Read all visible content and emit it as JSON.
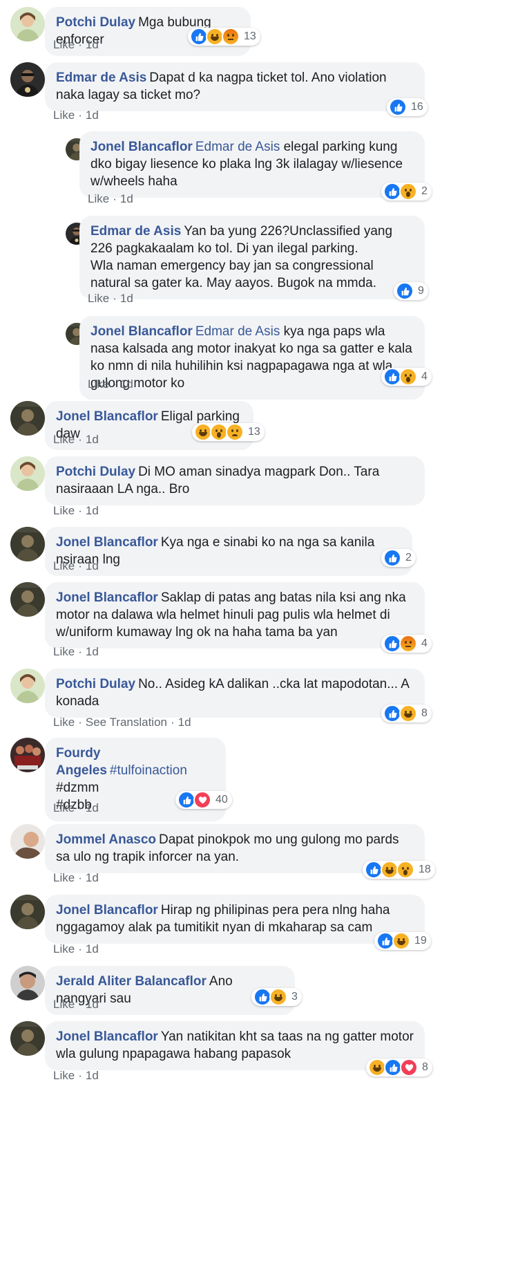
{
  "comments": [
    {
      "name": "Potchi Dulay",
      "text": "Mga bubung enforcer",
      "like": "Like",
      "time": "1d",
      "reactions": [
        "like",
        "haha",
        "angry"
      ],
      "count": "13"
    },
    {
      "name": "Edmar de Asis",
      "text": "Dapat d ka nagpa ticket tol. Ano violation naka lagay sa ticket mo?",
      "like": "Like",
      "time": "1d",
      "reactions": [
        "like"
      ],
      "count": "16"
    },
    {
      "name": "Jonel Blancaflor",
      "mention": "Edmar de Asis",
      "text": "elegal parking kung dko bigay liesence ko plaka lng 3k ilalagay w/liesence w/wheels haha",
      "like": "Like",
      "time": "1d",
      "reactions": [
        "like",
        "wow"
      ],
      "count": "2"
    },
    {
      "name": "Edmar de Asis",
      "text": "Yan ba yung 226?Unclassified yang 226 pagkakaalam ko tol. Di yan ilegal parking.\nWla naman emergency bay jan sa congressional natural sa gater ka. May aayos. Bugok na mmda.",
      "like": "Like",
      "time": "1d",
      "reactions": [
        "like"
      ],
      "count": "9"
    },
    {
      "name": "Jonel Blancaflor",
      "mention": "Edmar de Asis",
      "text": "kya nga paps wla nasa kalsada ang motor inakyat ko nga sa gatter e kala ko nmn di nila huhilihin ksi nagpapagawa nga at wla gulong motor ko",
      "like": "Like",
      "time": "1d",
      "reactions": [
        "like",
        "wow"
      ],
      "count": "4"
    },
    {
      "name": "Jonel Blancaflor",
      "text": "Eligal parking daw",
      "like": "Like",
      "time": "1d",
      "reactions": [
        "haha",
        "wow",
        "sad"
      ],
      "count": "13"
    },
    {
      "name": "Potchi Dulay",
      "text": "Di MO aman sinadya magpark Don.. Tara nasiraaan LA nga.. Bro",
      "like": "Like",
      "time": "1d",
      "reactions": [],
      "count": ""
    },
    {
      "name": "Jonel Blancaflor",
      "text": "Kya nga e sinabi ko na nga sa kanila nsiraan lng",
      "like": "Like",
      "time": "1d",
      "reactions": [
        "like"
      ],
      "count": "2"
    },
    {
      "name": "Jonel Blancaflor",
      "text": "Saklap di patas ang batas nila ksi ang nka motor na dalawa wla helmet hinuli pag pulis wla helmet di w/uniform kumaway lng ok na haha tama ba yan",
      "like": "Like",
      "time": "1d",
      "reactions": [
        "like",
        "angry"
      ],
      "count": "4"
    },
    {
      "name": "Potchi Dulay",
      "text": "No.. Asideg kA dalikan ..cka lat mapodotan... A konada",
      "like": "Like",
      "extra": "See Translation",
      "time": "1d",
      "reactions": [
        "like",
        "haha"
      ],
      "count": "8"
    },
    {
      "name": "Fourdy Angeles",
      "mention": "#tulfoinaction",
      "text": "#dzmm\n#dzbb",
      "like": "Like",
      "time": "1d",
      "reactions": [
        "like",
        "love"
      ],
      "count": "40"
    },
    {
      "name": "Jommel Anasco",
      "text": "Dapat pinokpok mo ung gulong mo pards sa ulo ng trapik inforcer na yan.",
      "like": "Like",
      "time": "1d",
      "reactions": [
        "like",
        "haha",
        "wow"
      ],
      "count": "18"
    },
    {
      "name": "Jonel Blancaflor",
      "text": "Hirap ng philipinas pera pera nlng haha nggagamoy alak pa tumitikit nyan di mkaharap sa cam",
      "like": "Like",
      "time": "1d",
      "reactions": [
        "like",
        "haha"
      ],
      "count": "19"
    },
    {
      "name": "Jerald Aliter Balancaflor",
      "text": "Ano nangyari sau",
      "like": "Like",
      "time": "1d",
      "reactions": [
        "like",
        "haha"
      ],
      "count": "3"
    },
    {
      "name": "Jonel Blancaflor",
      "text": "Yan natikitan kht sa taas na ng gatter motor wla gulung npapagawa habang papasok",
      "like": "Like",
      "time": "1d",
      "reactions": [
        "haha",
        "like",
        "love"
      ],
      "count": "8"
    }
  ],
  "colors": {
    "name": "#385898",
    "bubble": "#f2f3f5",
    "meta": "#606770",
    "like": "#1877f2"
  }
}
